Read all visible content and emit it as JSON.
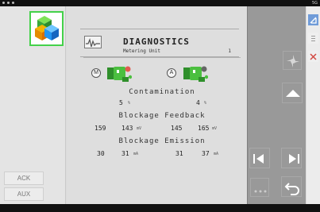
{
  "status": {
    "right_text": "5G"
  },
  "left_panel": {
    "ack_label": "ACK",
    "aux_label": "AUX"
  },
  "diagnostics": {
    "title": "DIAGNOSTICS",
    "subtitle": "Metering Unit",
    "unit_number": "1",
    "mode_m": "M",
    "mode_a": "A",
    "contamination": {
      "label": "Contamination",
      "left": "5",
      "left_unit": "%",
      "right": "4",
      "right_unit": "%"
    },
    "blockage_feedback": {
      "label": "Blockage Feedback",
      "left_a": "159",
      "left_b": "143",
      "left_unit": "mV",
      "right_a": "145",
      "right_b": "165",
      "right_unit": "mV"
    },
    "blockage_emission": {
      "label": "Blockage Emission",
      "left_a": "30",
      "left_b": "31",
      "left_unit": "mA",
      "right_a": "31",
      "right_b": "37",
      "right_unit": "mA"
    }
  },
  "icons": {
    "status_left": "status-dots-icon",
    "logo": "cubes-logo-icon",
    "waveform": "waveform-icon",
    "meter_green": "green-meter-icon",
    "meter_green_right": "green-meter-icon-2",
    "fan": "fan-icon",
    "up": "up-arrow-icon",
    "prev": "previous-arrow-icon",
    "next": "next-arrow-icon",
    "back": "back-arrow-icon",
    "more": "more-icon",
    "minimize": "minimize-icon",
    "menu": "menu-icon",
    "close": "close-icon"
  },
  "colors": {
    "green": "#4bbf3f",
    "dark_green": "#2f8f2b",
    "red": "#e15b4f",
    "panel_gray": "#999999",
    "screen_gray": "#dedede"
  }
}
